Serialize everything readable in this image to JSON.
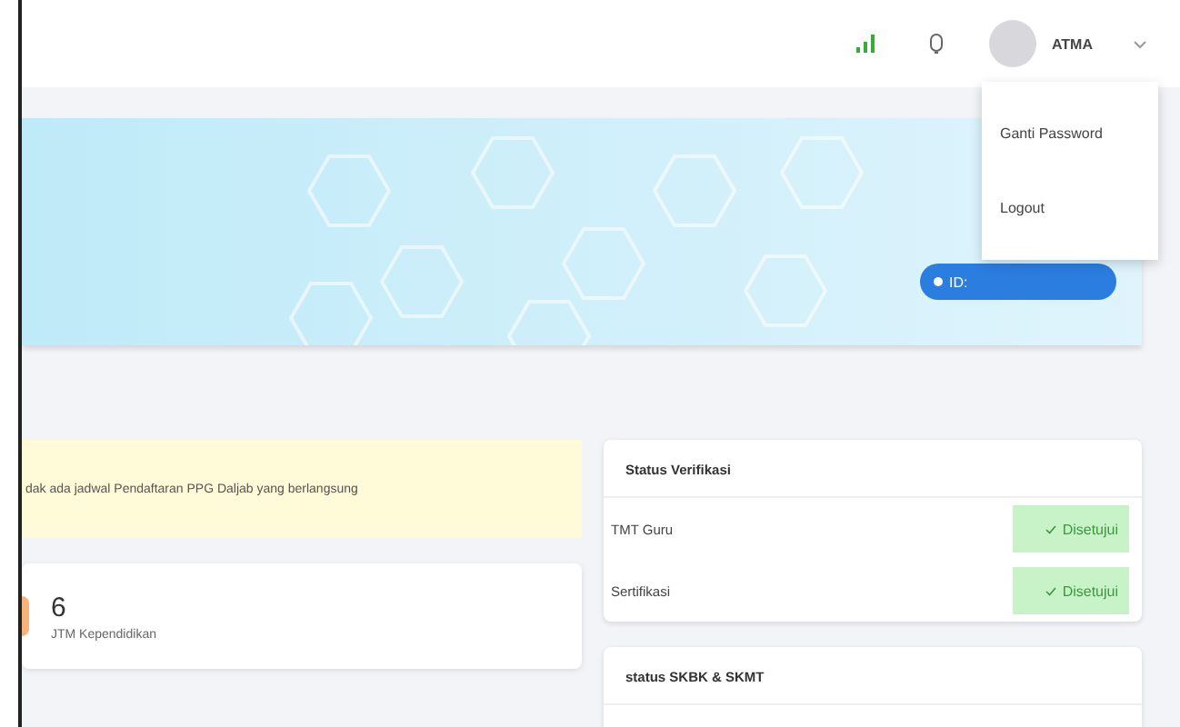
{
  "header": {
    "user": "ATMA"
  },
  "menu": {
    "items": [
      {
        "label": "Ganti Password"
      },
      {
        "label": "Logout"
      }
    ]
  },
  "banner": {
    "button": "ID:"
  },
  "alert": {
    "text": "dak ada jadwal Pendaftaran PPG Daljab yang berlangsung"
  },
  "stat": {
    "value": "6",
    "label": "JTM Kependidikan"
  },
  "verification": {
    "title": "Status Verifikasi",
    "rows": [
      {
        "label": "TMT Guru",
        "status": "Disetujui",
        "approved": true
      },
      {
        "label": "Sertifikasi",
        "status": "Disetujui",
        "approved": true
      }
    ]
  },
  "skbk": {
    "title": "status SKBK & SKMT"
  }
}
